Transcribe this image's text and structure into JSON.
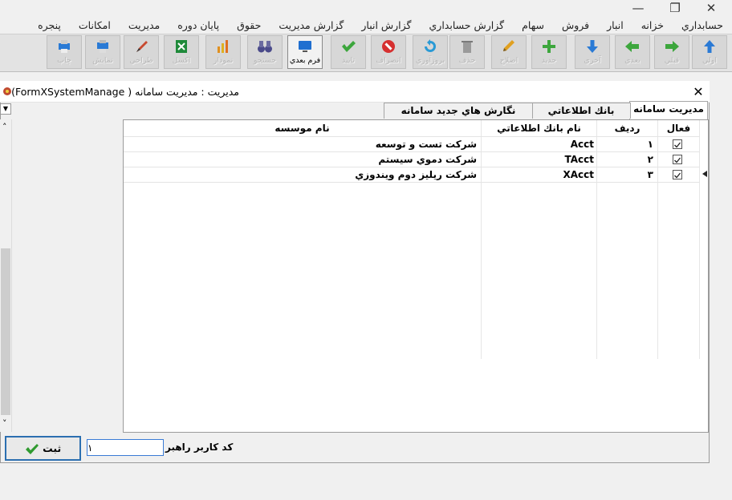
{
  "menu": [
    "حسابداري",
    "خزانه",
    "انبار",
    "فروش",
    "سهام",
    "گزارش حسابداري",
    "گزارش انبار",
    "گزارش مديريت",
    "حقوق",
    "پايان دوره",
    "مديريت",
    "امكانات",
    "پنجره"
  ],
  "toolbar": [
    {
      "label": "اولي",
      "icon": "arrow-up-icon",
      "color": "#2a7ad5"
    },
    {
      "label": "قبلي",
      "icon": "arrow-right-icon",
      "color": "#3ca63c"
    },
    {
      "label": "بعدي",
      "icon": "arrow-left-icon",
      "color": "#3ca63c"
    },
    {
      "label": "آخري",
      "icon": "arrow-down-icon",
      "color": "#2a7ad5"
    },
    {
      "label": "جديد",
      "icon": "plus-icon",
      "color": "#3ca63c"
    },
    {
      "label": "اصلاح",
      "icon": "pencil-icon",
      "color": "#e0a020"
    },
    {
      "label": "حذف",
      "icon": "trash-icon",
      "color": "#8a8a8a"
    },
    {
      "label": "بروزآوري",
      "icon": "refresh-icon",
      "color": "#2a9ad5"
    },
    {
      "label": "انصراف",
      "icon": "stop-icon",
      "color": "#d63030"
    },
    {
      "label": "تاييد",
      "icon": "check-icon",
      "color": "#3ca63c"
    },
    {
      "label": "فرم بعدي",
      "icon": "monitor-icon",
      "color": "#1f6fd0"
    },
    {
      "label": "جستجو",
      "icon": "binoculars-icon",
      "color": "#4a4a8a"
    },
    {
      "label": "نمودار",
      "icon": "bar-chart-icon",
      "color": "#e09020"
    },
    {
      "label": "اكسل",
      "icon": "excel-icon",
      "color": "#1f8a3a"
    },
    {
      "label": "طراحي",
      "icon": "brush-icon",
      "color": "#c84a30"
    },
    {
      "label": "نمايش",
      "icon": "preview-icon",
      "color": "#2a7ad5"
    },
    {
      "label": "چاپ",
      "icon": "printer-icon",
      "color": "#2a7ad5"
    }
  ],
  "dialog": {
    "title": "مديريت : مديريت سامانه ( FormXSystemManage)",
    "close": "✕"
  },
  "tabs": [
    "مديريت سامانه",
    "بانك اطلاعاتي",
    "نگارش هاي جديد سامانه"
  ],
  "grid": {
    "headers": {
      "active": "فعال",
      "row": "رديف",
      "db": "نام بانك اطلاعاتي",
      "org": "نام موسسه"
    },
    "rows": [
      {
        "active": true,
        "row": "۱",
        "db": "Acct",
        "org": "شركت تست و توسعه"
      },
      {
        "active": true,
        "row": "۲",
        "db": "TAcct",
        "org": "شركت دموي سيستم"
      },
      {
        "active": true,
        "row": "۳",
        "db": "XAcct",
        "org": "شركت ريليز دوم ويندوزي"
      }
    ]
  },
  "footer": {
    "save_label": "ثبت",
    "code_label": "كد كاربر راهبر",
    "code_value": "۱"
  }
}
